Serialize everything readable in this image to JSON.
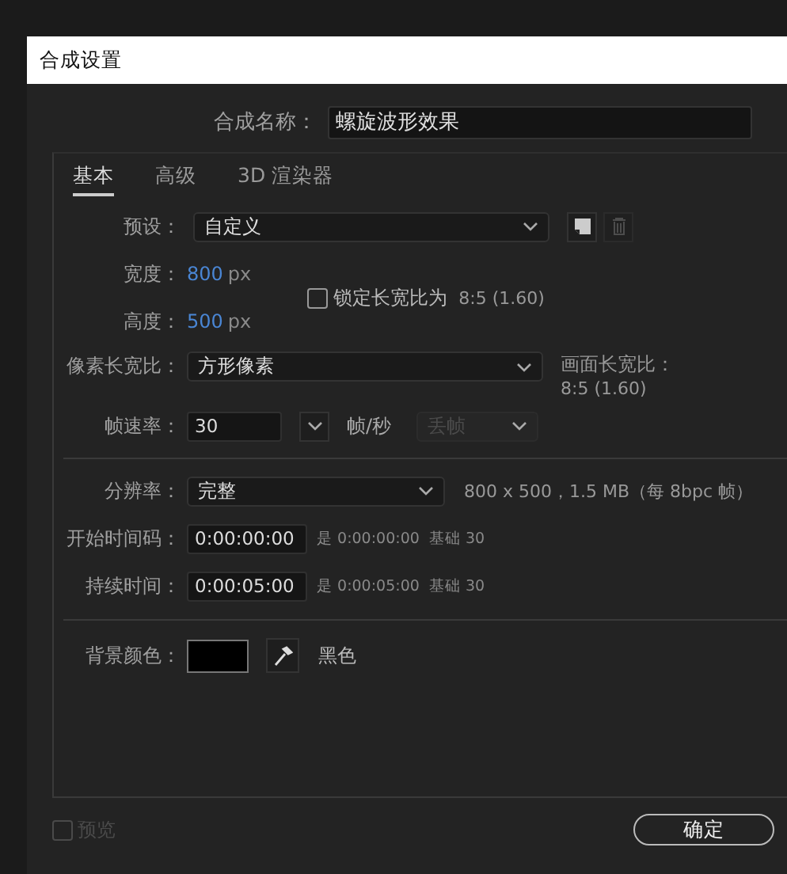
{
  "window": {
    "title": "合成设置"
  },
  "name_field": {
    "label": "合成名称：",
    "value": "螺旋波形效果"
  },
  "tabs": [
    {
      "label": "基本",
      "selected": true
    },
    {
      "label": "高级",
      "selected": false
    },
    {
      "label": "3D 渲染器",
      "selected": false
    }
  ],
  "preset": {
    "label": "预设：",
    "value": "自定义"
  },
  "width": {
    "label": "宽度：",
    "value": "800",
    "unit": "px"
  },
  "height": {
    "label": "高度：",
    "value": "500",
    "unit": "px"
  },
  "lock_aspect": {
    "label": "锁定长宽比为",
    "ratio": "8:5 (1.60)",
    "checked": false
  },
  "pixel_aspect": {
    "label": "像素长宽比：",
    "value": "方形像素"
  },
  "frame_aspect": {
    "label": "画面长宽比：",
    "value": "8:5 (1.60)"
  },
  "frame_rate": {
    "label": "帧速率：",
    "value": "30",
    "unit": "帧/秒",
    "drop_frame": {
      "value": "丢帧",
      "disabled": true
    }
  },
  "resolution": {
    "label": "分辨率：",
    "value": "完整",
    "info": "800 x 500，1.5 MB（每 8bpc 帧）"
  },
  "start_timecode": {
    "label": "开始时间码：",
    "value": "0:00:00:00",
    "equals": "是 0:00:00:00",
    "base": "基础 30"
  },
  "duration": {
    "label": "持续时间：",
    "value": "0:00:05:00",
    "equals": "是 0:00:05:00",
    "base": "基础 30"
  },
  "background": {
    "label": "背景颜色：",
    "color": "#000000",
    "name": "黑色"
  },
  "preview": {
    "label": "预览",
    "checked": false,
    "disabled": true
  },
  "ok_button": "确定"
}
